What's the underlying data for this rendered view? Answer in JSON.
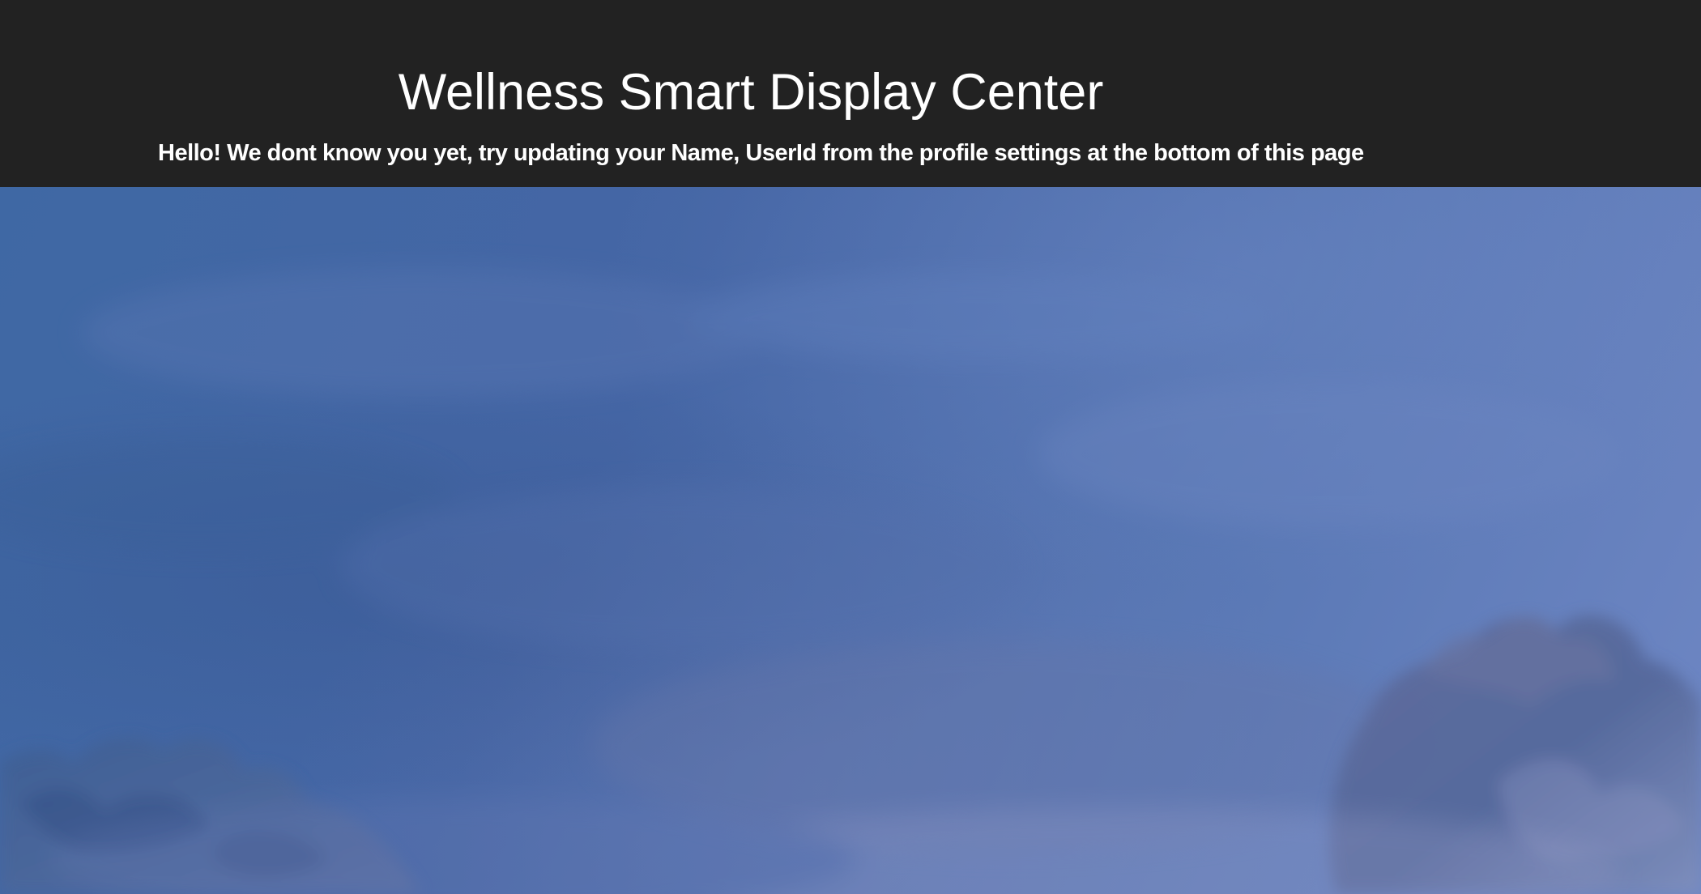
{
  "header": {
    "title": "Wellness Smart Display Center",
    "greeting": "Hello! We dont know you yet, try updating your Name, UserId from the profile settings at the bottom of this page"
  },
  "background": {
    "image_name": "sky-with-clouds-image"
  },
  "colors": {
    "header_background": "#222222",
    "header_text": "#ffffff",
    "sky_blue": "#4a6aa3",
    "cloud_gray_blue": "#5d6d9d"
  }
}
